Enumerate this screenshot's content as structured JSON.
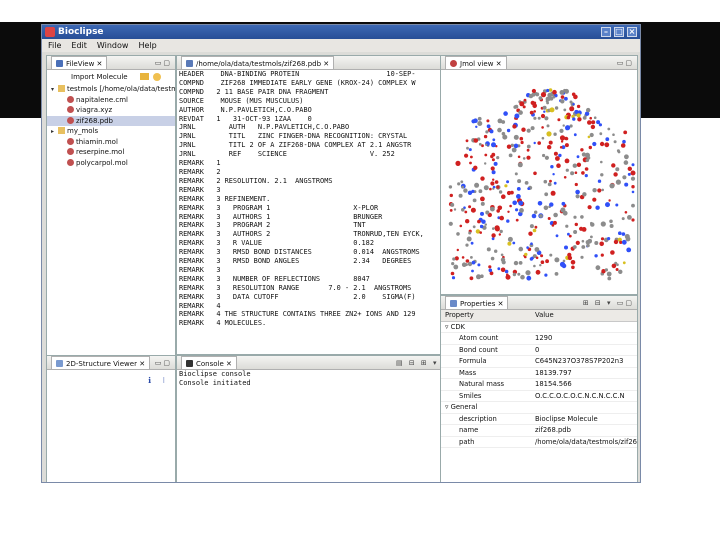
{
  "window": {
    "title": "Bioclipse",
    "menu": [
      "File",
      "Edit",
      "Window",
      "Help"
    ]
  },
  "fileview": {
    "tab_label": "FileView",
    "import_label": "Import Molecule",
    "tree": [
      {
        "label": "testmols [/home/ola/data/testmols]",
        "level": 0,
        "expanded": true
      },
      {
        "label": "napitalene.cml",
        "level": 1
      },
      {
        "label": "viagra.xyz",
        "level": 1
      },
      {
        "label": "zif268.pdb",
        "level": 1,
        "selected": true
      },
      {
        "label": "my_mols",
        "level": 0,
        "expanded": false
      },
      {
        "label": "thiamin.mol",
        "level": 1
      },
      {
        "label": "reserpine.mol",
        "level": 1
      },
      {
        "label": "polycarpol.mol",
        "level": 1
      }
    ]
  },
  "structure_viewer": {
    "tab_label": "2D-Structure Viewer"
  },
  "editor": {
    "tab_label": "/home/ola/data/testmols/zif268.pdb",
    "lines": [
      "HEADER    DNA-BINDING PROTEIN                     10-SEP-",
      "COMPND    ZIF268 IMMEDIATE EARLY GENE (KROX-24) COMPLEX W",
      "COMPND   2 11 BASE PAIR DNA FRAGMENT",
      "SOURCE    MOUSE (MUS MUSCULUS)",
      "AUTHOR    N.P.PAVLETICH,C.O.PABO",
      "REVDAT   1   31-OCT-93 1ZAA    0",
      "JRNL        AUTH   N.P.PAVLETICH,C.O.PABO",
      "JRNL        TITL   ZINC FINGER-DNA RECOGNITION: CRYSTAL",
      "JRNL        TITL 2 OF A ZIF268-DNA COMPLEX AT 2.1 ANGSTR",
      "JRNL        REF    SCIENCE                    V. 252",
      "REMARK   1",
      "REMARK   2",
      "REMARK   2 RESOLUTION. 2.1  ANGSTROMS",
      "REMARK   3",
      "REMARK   3 REFINEMENT.",
      "REMARK   3   PROGRAM 1                    X-PLOR",
      "REMARK   3   AUTHORS 1                    BRUNGER",
      "REMARK   3   PROGRAM 2                    TNT",
      "REMARK   3   AUTHORS 2                    TRONRUD,TEN EYCK,",
      "REMARK   3   R VALUE                      0.182",
      "REMARK   3   RMSD BOND DISTANCES          0.014  ANGSTROMS",
      "REMARK   3   RMSD BOND ANGLES             2.34   DEGREES",
      "REMARK   3",
      "REMARK   3   NUMBER OF REFLECTIONS        8047",
      "REMARK   3   RESOLUTION RANGE       7.0 - 2.1  ANGSTROMS",
      "REMARK   3   DATA CUTOFF                  2.0    SIGMA(F)",
      "REMARK   4",
      "REMARK   4 THE STRUCTURE CONTAINS THREE ZN2+ IONS AND 129",
      "REMARK   4 MOLECULES."
    ]
  },
  "console": {
    "tab_label": "Console",
    "title": "Bioclipse console",
    "lines": [
      "Console initiated"
    ]
  },
  "jmol": {
    "tab_label": "Jmol view"
  },
  "properties": {
    "tab_label": "Properties",
    "col_property": "Property",
    "col_value": "Value",
    "categories": [
      {
        "name": "CDK",
        "rows": [
          {
            "key": "Atom count",
            "value": "1290"
          },
          {
            "key": "Bond count",
            "value": "0"
          },
          {
            "key": "Formula",
            "value": "C645N237O378S7P202n3"
          },
          {
            "key": "Mass",
            "value": "18139.797"
          },
          {
            "key": "Natural mass",
            "value": "18154.566"
          },
          {
            "key": "Smiles",
            "value": "O.C.C.O.C.O.C.N.C.N.C.C.N"
          }
        ]
      },
      {
        "name": "General",
        "rows": [
          {
            "key": "description",
            "value": "Bioclipse Molecule"
          },
          {
            "key": "name",
            "value": "zif268.pdb"
          },
          {
            "key": "path",
            "value": "/home/ola/data/testmols/zif26"
          }
        ]
      }
    ]
  },
  "colors": {
    "titlebar": "#3062b0",
    "selection": "#c8d0e6",
    "atom_carbon": "#8c8c8c",
    "atom_oxygen": "#d02020",
    "atom_nitrogen": "#3050f8",
    "atom_sulfur": "#d8c020"
  }
}
